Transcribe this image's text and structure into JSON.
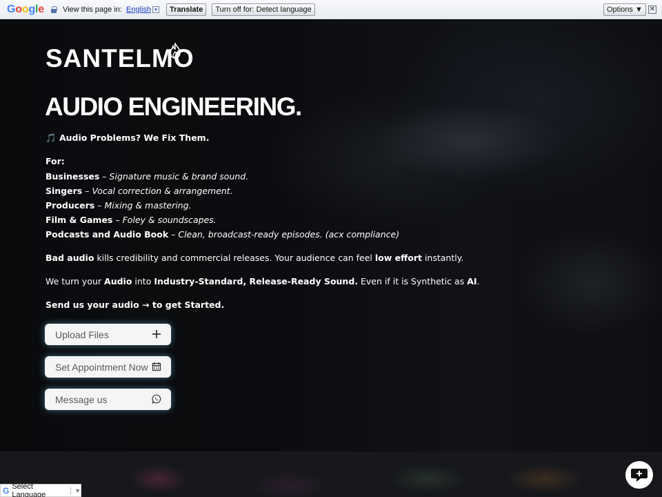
{
  "translate_bar": {
    "view_label": "View this page in:",
    "language": "English",
    "dropdown_glyph": "▾",
    "translate_label": "Translate",
    "turn_off_label": "Turn off for: Detect language",
    "options_label": "Options ▼",
    "close_glyph": "✕"
  },
  "brand": {
    "logo_text": "SANTELMO"
  },
  "hero": {
    "headline": "AUDIO ENGINEERING.",
    "tagline_icon": "🎵",
    "tagline": "Audio Problems? We Fix Them.",
    "for_label": "For:",
    "audiences": [
      {
        "who": "Businesses",
        "what": "Signature music & brand sound."
      },
      {
        "who": "Singers",
        "what": "Vocal correction & arrangement."
      },
      {
        "who": "Producers",
        "what": "Mixing & mastering."
      },
      {
        "who": "Film & Games",
        "what": "Foley & soundscapes."
      },
      {
        "who": "Podcasts and Audio Book",
        "what": "Clean, broadcast-ready episodes. (acx compliance)"
      }
    ],
    "dash": " – ",
    "p1": {
      "b1": "Bad audio",
      "t1": " kills credibility and commercial releases. Your audience can feel ",
      "b2": "low effort",
      "t2": " instantly."
    },
    "p2": {
      "t1": "We turn your ",
      "b1": "Audio",
      "t2": " into ",
      "b2": "Industry-Standard, Release-Ready Sound.",
      "t3": " Even if it is Synthetic as ",
      "b3": "AI",
      "t4": "."
    },
    "cta_text": "Send us your audio → to get Started."
  },
  "buttons": {
    "upload": {
      "label": "Upload Files",
      "icon": "plus-icon"
    },
    "appointment": {
      "label": "Set Appointment Now",
      "icon": "calendar-icon"
    },
    "message": {
      "label": "Message us",
      "icon": "whatsapp-icon"
    }
  },
  "language_selector": {
    "label": "Select Language",
    "arrow": "▼"
  },
  "chat": {
    "icon": "chat-icon"
  },
  "colors": {
    "button_glow": "#64bee6",
    "translate_link": "#1a3cc4"
  }
}
